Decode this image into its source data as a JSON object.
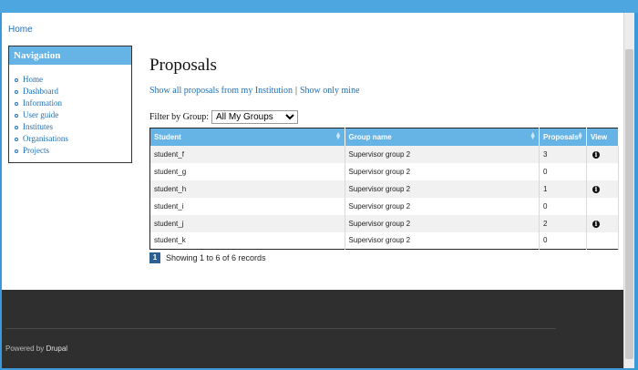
{
  "breadcrumb": {
    "home": "Home"
  },
  "navigation": {
    "title": "Navigation",
    "items": [
      "Home",
      "Dashboard",
      "Information",
      "User guide",
      "Institutes",
      "Organisations",
      "Projects"
    ]
  },
  "main": {
    "title": "Proposals",
    "links": {
      "all": "Show all proposals from my Institution",
      "separator": "|",
      "mine": "Show only mine"
    },
    "filter": {
      "label": "Filter by Group:",
      "selected": "All My Groups"
    }
  },
  "table": {
    "columns": [
      "Student",
      "Group name",
      "Proposals",
      "View"
    ],
    "rows": [
      {
        "student": "student_f",
        "group": "Supervisor group 2",
        "proposals": "3",
        "view": true
      },
      {
        "student": "student_g",
        "group": "Supervisor group 2",
        "proposals": "0",
        "view": false
      },
      {
        "student": "student_h",
        "group": "Supervisor group 2",
        "proposals": "1",
        "view": true
      },
      {
        "student": "student_i",
        "group": "Supervisor group 2",
        "proposals": "0",
        "view": false
      },
      {
        "student": "student_j",
        "group": "Supervisor group 2",
        "proposals": "2",
        "view": true
      },
      {
        "student": "student_k",
        "group": "Supervisor group 2",
        "proposals": "0",
        "view": false
      }
    ]
  },
  "pager": {
    "page": "1",
    "info": "Showing 1 to 6 of 6 records"
  },
  "footer": {
    "powered_prefix": "Powered by",
    "powered_link": "Drupal"
  },
  "colors": {
    "header_blue": "#66b3e6",
    "link_blue": "#1f6fb5",
    "footer_bg": "#2f2f2f"
  },
  "icons": {
    "view": "info-icon"
  }
}
